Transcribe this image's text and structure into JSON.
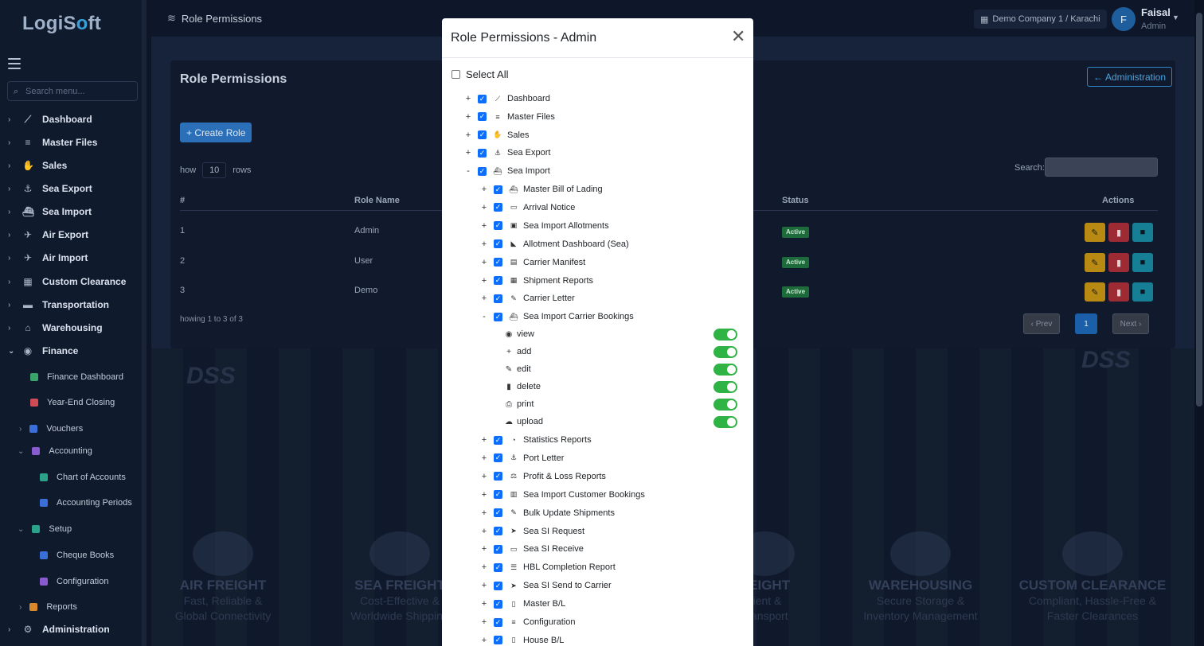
{
  "sidebar": {
    "logo_a": "LogiS",
    "logo_b": "o",
    "logo_c": "ft",
    "search_placeholder": "Search menu...",
    "items": [
      {
        "label": "Dashboard",
        "icon": "chart-line-icon"
      },
      {
        "label": "Master Files",
        "icon": "database-icon"
      },
      {
        "label": "Sales",
        "icon": "handshake-icon"
      },
      {
        "label": "Sea Export",
        "icon": "anchor-icon"
      },
      {
        "label": "Sea Import",
        "icon": "ship-icon"
      },
      {
        "label": "Air Export",
        "icon": "plane-icon"
      },
      {
        "label": "Air Import",
        "icon": "plane-landing-icon"
      },
      {
        "label": "Custom Clearance",
        "icon": "building-icon"
      },
      {
        "label": "Transportation",
        "icon": "truck-icon"
      },
      {
        "label": "Warehousing",
        "icon": "warehouse-icon"
      },
      {
        "label": "Finance",
        "icon": "coins-icon"
      }
    ],
    "finance_sub": [
      {
        "label": "Finance Dashboard",
        "color": "#3aa56a"
      },
      {
        "label": "Year-End Closing",
        "color": "#d04b55"
      },
      {
        "label": "Vouchers",
        "color": "#3a6fd8"
      },
      {
        "label": "Accounting",
        "color": "#8a5bd0"
      },
      {
        "label": "Chart of Accounts",
        "color": "#2aa38a"
      },
      {
        "label": "Accounting Periods",
        "color": "#3a6fd8"
      },
      {
        "label": "Setup",
        "color": "#2aa38a"
      },
      {
        "label": "Cheque Books",
        "color": "#3a6fd8"
      },
      {
        "label": "Configuration",
        "color": "#8a5bd0"
      },
      {
        "label": "Reports",
        "color": "#d88a2a"
      }
    ],
    "administration": "Administration"
  },
  "header": {
    "breadcrumb": "Role Permissions",
    "company": "Demo Company 1 / Karachi",
    "avatar_letter": "F",
    "user_name": "Faisal",
    "user_role": "Admin"
  },
  "page": {
    "title": "Role Permissions",
    "admin_button": "Administration",
    "create_button": "+ Create Role",
    "show_prefix": "how",
    "show_count": "10",
    "show_suffix": "rows",
    "search_label": "Search:",
    "columns": {
      "num": "#",
      "role_name": "Role Name",
      "status": "Status",
      "actions": "Actions"
    },
    "rows": [
      {
        "num": "1",
        "role": "Admin",
        "status": "Active"
      },
      {
        "num": "2",
        "role": "User",
        "status": "Active"
      },
      {
        "num": "3",
        "role": "Demo",
        "status": "Active"
      }
    ],
    "showing": "howing 1 to 3 of 3",
    "prev": "‹ Prev",
    "page_one": "1",
    "next": "Next ›",
    "services": [
      {
        "title": "AIR FREIGHT",
        "l1": "Fast, Reliable &",
        "l2": "Global Connectivity"
      },
      {
        "title": "SEA FREIGHT",
        "l1": "Cost-Effective &",
        "l2": "Worldwide Shipping"
      },
      {
        "title": "REIGHT",
        "l1": "cient &",
        "l2": "Transport"
      },
      {
        "title": "WAREHOUSING",
        "l1": "Secure Storage &",
        "l2": "Inventory Management"
      },
      {
        "title": "CUSTOM CLEARANCE",
        "l1": "Compliant, Hassle-Free &",
        "l2": "Faster Clearances"
      }
    ],
    "dss_left": "DSS",
    "dss_right": "DSS"
  },
  "modal": {
    "title": "Role Permissions - Admin",
    "select_all": "Select All",
    "top_modules": [
      {
        "toggle": "+",
        "label": "Dashboard",
        "icon": "chart-line-icon"
      },
      {
        "toggle": "+",
        "label": "Master Files",
        "icon": "database-icon"
      },
      {
        "toggle": "+",
        "label": "Sales",
        "icon": "handshake-icon"
      },
      {
        "toggle": "+",
        "label": "Sea Export",
        "icon": "anchor-icon"
      },
      {
        "toggle": "-",
        "label": "Sea Import",
        "icon": "ship-icon"
      }
    ],
    "sea_import_children_a": [
      {
        "toggle": "+",
        "label": "Master Bill of Lading",
        "icon": "ship-icon"
      },
      {
        "toggle": "+",
        "label": "Arrival Notice",
        "icon": "inbox-icon"
      },
      {
        "toggle": "+",
        "label": "Sea Import Allotments",
        "icon": "box-icon"
      },
      {
        "toggle": "+",
        "label": "Allotment Dashboard (Sea)",
        "icon": "chart-area-icon"
      },
      {
        "toggle": "+",
        "label": "Carrier Manifest",
        "icon": "file-export-icon"
      },
      {
        "toggle": "+",
        "label": "Shipment Reports",
        "icon": "table-icon"
      },
      {
        "toggle": "+",
        "label": "Carrier Letter",
        "icon": "file-signature-icon"
      },
      {
        "toggle": "-",
        "label": "Sea Import Carrier Bookings",
        "icon": "ship-icon"
      }
    ],
    "permissions": [
      {
        "label": "view",
        "icon": "eye-icon",
        "on": true
      },
      {
        "label": "add",
        "icon": "plus-icon",
        "on": true
      },
      {
        "label": "edit",
        "icon": "pencil-icon",
        "on": true
      },
      {
        "label": "delete",
        "icon": "trash-icon",
        "on": true
      },
      {
        "label": "print",
        "icon": "print-icon",
        "on": true
      },
      {
        "label": "upload",
        "icon": "cloud-upload-icon",
        "on": true
      }
    ],
    "sea_import_children_b": [
      {
        "toggle": "+",
        "label": "Statistics Reports",
        "icon": "chart-pie-icon"
      },
      {
        "toggle": "+",
        "label": "Port Letter",
        "icon": "anchor-icon"
      },
      {
        "toggle": "+",
        "label": "Profit & Loss Reports",
        "icon": "balance-icon"
      },
      {
        "toggle": "+",
        "label": "Sea Import Customer Bookings",
        "icon": "clipboard-icon"
      },
      {
        "toggle": "+",
        "label": "Bulk Update Shipments",
        "icon": "edit-icon"
      },
      {
        "toggle": "+",
        "label": "Sea SI Request",
        "icon": "paper-plane-icon"
      },
      {
        "toggle": "+",
        "label": "Sea SI Receive",
        "icon": "inbox-icon"
      },
      {
        "toggle": "+",
        "label": "HBL Completion Report",
        "icon": "list-check-icon"
      },
      {
        "toggle": "+",
        "label": "Sea SI Send to Carrier",
        "icon": "paper-plane-icon"
      },
      {
        "toggle": "+",
        "label": "Master B/L",
        "icon": "file-icon"
      },
      {
        "toggle": "+",
        "label": "Configuration",
        "icon": "sliders-icon"
      },
      {
        "toggle": "+",
        "label": "House B/L",
        "icon": "file-icon"
      }
    ]
  }
}
